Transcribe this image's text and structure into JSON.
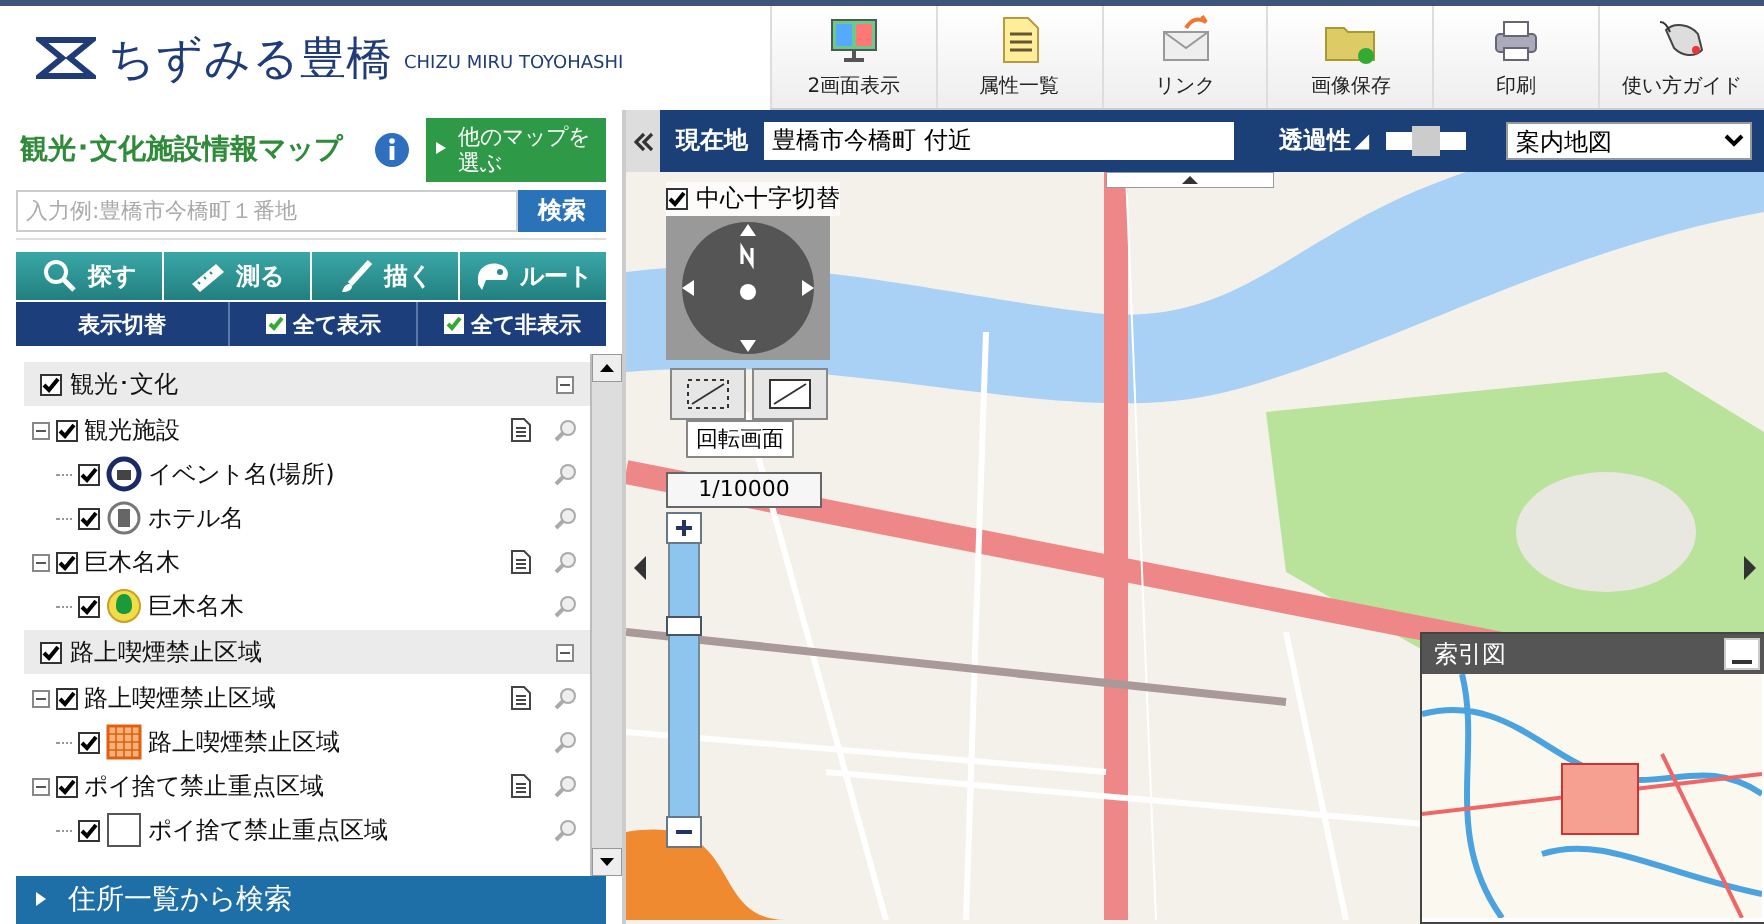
{
  "header": {
    "logo": "ちずみる豊橋",
    "logo_sub": "CHIZU MIRU TOYOHASHI"
  },
  "toolbar": [
    {
      "label": "2画面表示",
      "kind": "dual"
    },
    {
      "label": "属性一覧",
      "kind": "list"
    },
    {
      "label": "リンク",
      "kind": "link"
    },
    {
      "label": "画像保存",
      "kind": "save"
    },
    {
      "label": "印刷",
      "kind": "print"
    },
    {
      "label": "使い方ガイド",
      "kind": "guide"
    }
  ],
  "panel": {
    "title": "観光･文化施設情報マップ",
    "other_map_button": "他のマップを選ぶ",
    "search": {
      "placeholder": "入力例:豊橋市今橋町１番地",
      "button": "検索"
    },
    "tools": [
      {
        "label": "探す",
        "kind": "search"
      },
      {
        "label": "測る",
        "kind": "ruler"
      },
      {
        "label": "描く",
        "kind": "brush"
      },
      {
        "label": "ルート",
        "kind": "route"
      }
    ],
    "display_bar": {
      "label": "表示切替",
      "show_all": "全て表示",
      "hide_all": "全て非表示"
    },
    "categories": [
      {
        "label": "観光･文化",
        "checked": true,
        "expanded": true,
        "layers": [
          {
            "label": "観光施設",
            "checked": true,
            "expanded": true,
            "children": [
              {
                "label": "イベント名(場所)",
                "checked": true,
                "kind": "event"
              },
              {
                "label": "ホテル名",
                "checked": true,
                "kind": "hotel"
              }
            ]
          },
          {
            "label": "巨木名木",
            "checked": true,
            "expanded": true,
            "children": [
              {
                "label": "巨木名木",
                "checked": true,
                "kind": "tree"
              }
            ]
          }
        ]
      },
      {
        "label": "路上喫煙禁止区域",
        "checked": true,
        "expanded": true,
        "layers": [
          {
            "label": "路上喫煙禁止区域",
            "checked": true,
            "expanded": true,
            "children": [
              {
                "label": "路上喫煙禁止区域",
                "checked": true,
                "kind": "grid"
              }
            ]
          },
          {
            "label": "ポイ捨て禁止重点区域",
            "checked": true,
            "expanded": true,
            "children": [
              {
                "label": "ポイ捨て禁止重点区域",
                "checked": true,
                "kind": "blank"
              }
            ]
          }
        ]
      }
    ],
    "address_search": "住所一覧から検索"
  },
  "map": {
    "location_label": "現在地",
    "location": "豊橋市今橋町 付近",
    "opacity_label": "透過性",
    "opacity": {
      "level": 0.45
    },
    "map_type": "案内地図",
    "crosshair": {
      "label": "中心十字切替",
      "checked": true
    },
    "rotate_tooltip": "回転画面",
    "scale": "1/10000",
    "zoom": {
      "level": 0.72
    },
    "index_map": {
      "title": "索引図"
    }
  }
}
